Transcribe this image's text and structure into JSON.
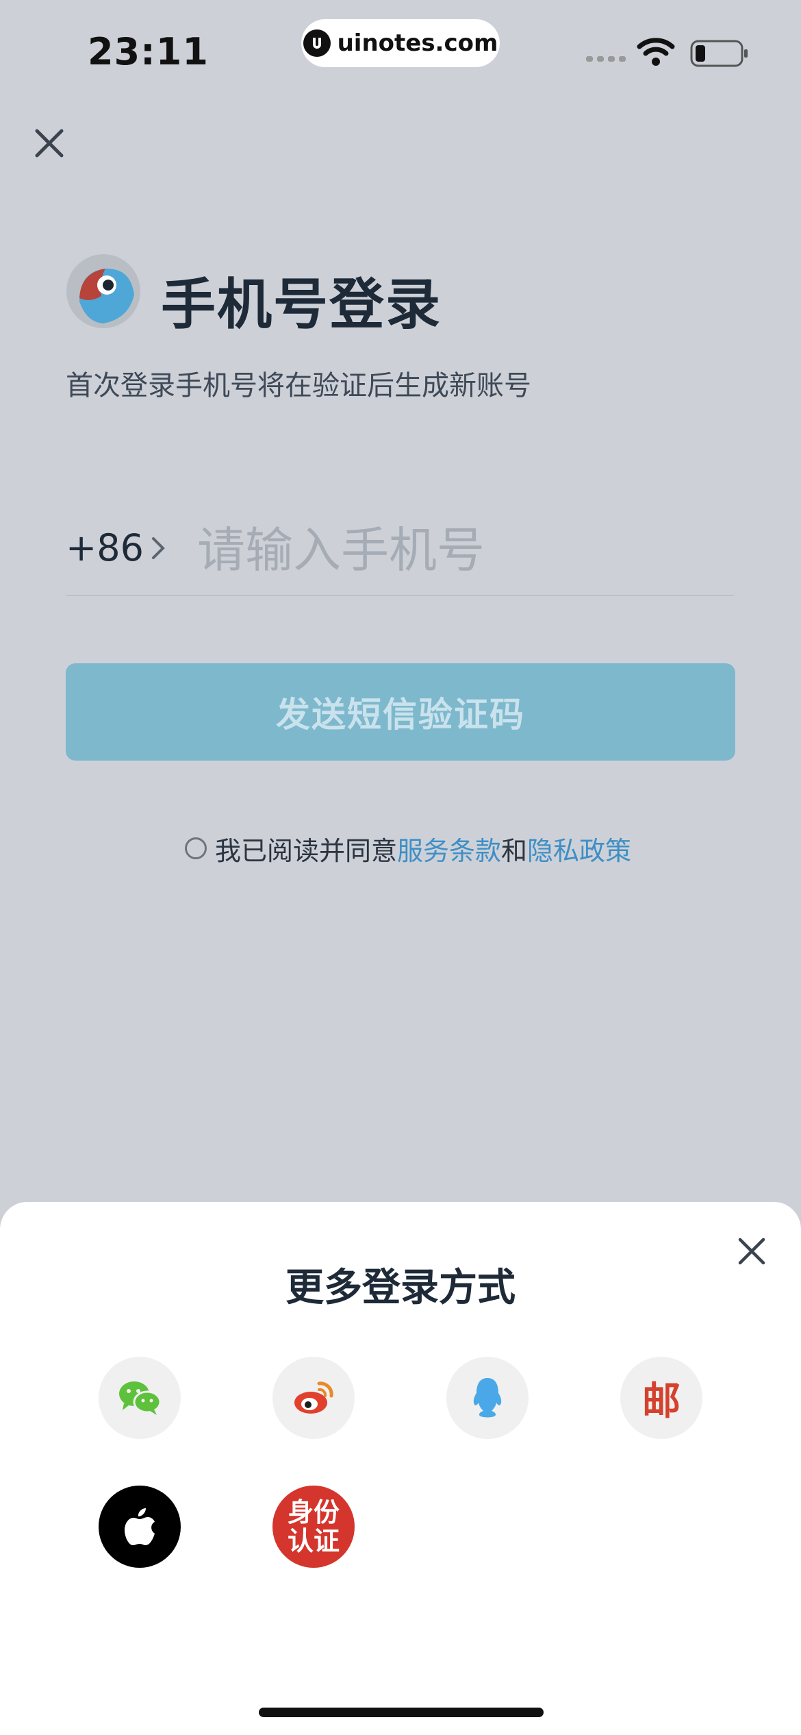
{
  "status_bar": {
    "time": "23:11",
    "url": "uinotes.com"
  },
  "login": {
    "title": "手机号登录",
    "subtitle": "首次登录手机号将在验证后生成新账号",
    "country_code": "+86",
    "phone_placeholder": "请输入手机号",
    "send_button": "发送短信验证码",
    "agree_prefix": "我已阅读并同意",
    "terms_link": "服务条款",
    "agree_and": "和",
    "privacy_link": "隐私政策"
  },
  "more_login": {
    "title": "更多登录方式",
    "options": [
      {
        "id": "wechat",
        "icon": "wechat-icon"
      },
      {
        "id": "weibo",
        "icon": "weibo-icon"
      },
      {
        "id": "qq",
        "icon": "qq-icon"
      },
      {
        "id": "mail",
        "icon": "mail-icon",
        "glyph": "邮"
      },
      {
        "id": "apple",
        "icon": "apple-icon"
      },
      {
        "id": "id-verify",
        "icon": "id-verify-icon",
        "glyph_line1": "身份",
        "glyph_line2": "认证"
      }
    ]
  },
  "colors": {
    "background": "#cdd1d7",
    "button_disabled": "#7db8cd",
    "link": "#3f8fc6",
    "wechat": "#5ec13b",
    "weibo": "#e0402c",
    "qq": "#4aa8e8",
    "id_verify": "#d4352c"
  }
}
